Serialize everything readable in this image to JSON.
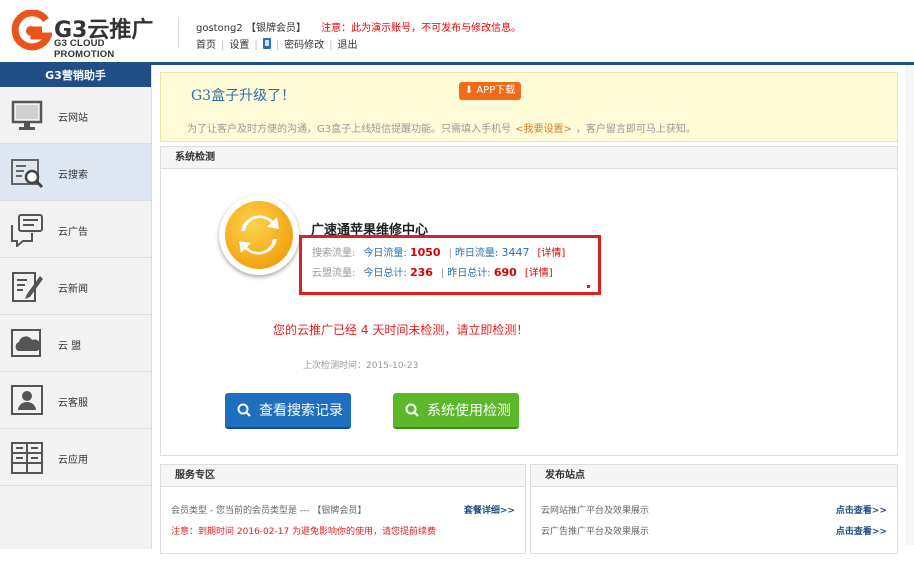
{
  "header": {
    "logo_title": "G3云推广",
    "logo_subtitle": "G3 CLOUD PROMOTION",
    "username": "gostong2",
    "member_level": "【银牌会员】",
    "demo_notice": "注意：此为演示账号，不可发布与修改信息。",
    "nav": [
      "首页",
      "设置",
      "密码修改",
      "退出"
    ]
  },
  "sidebar": {
    "title": "G3营销助手",
    "items": [
      {
        "label": "云网站",
        "icon": "monitor-icon"
      },
      {
        "label": "云搜索",
        "icon": "search-doc-icon"
      },
      {
        "label": "云广告",
        "icon": "chat-icon"
      },
      {
        "label": "云新闻",
        "icon": "edit-doc-icon"
      },
      {
        "label": "云 盟",
        "icon": "cloud-icon"
      },
      {
        "label": "云客服",
        "icon": "user-card-icon"
      },
      {
        "label": "云应用",
        "icon": "grid-icon"
      }
    ],
    "active_index": 1
  },
  "banner": {
    "title": "G3盒子升级了！",
    "app_button": "APP下载",
    "text_before": "为了让客户及时方便的沟通，G3盒子上线短信提醒功能。只需填入手机号",
    "link": "<我要设置>",
    "text_after": "，客户留言即可马上获知。"
  },
  "system_check": {
    "panel_title": "系统检测",
    "site_name": "广速通苹果维修中心",
    "search_traffic": {
      "key": "搜索流量:",
      "today_label": "今日流量:",
      "today_value": "1050",
      "yesterday_label": "昨日流量:",
      "yesterday_value": "3447",
      "detail": "[详情]"
    },
    "cloud_traffic": {
      "key": "云盟流量:",
      "today_label": "今日总计:",
      "today_value": "236",
      "yesterday_label": "昨日总计:",
      "yesterday_value": "690",
      "detail": "[详情]"
    },
    "warning_prefix": "您的云推广已经",
    "warning_days": "4",
    "warning_suffix": "天时间未检测，请立即检测！",
    "last_check": "上次检测时间：2015-10-23",
    "btn_search_records": "查看搜索记录",
    "btn_system_check": "系统使用检测"
  },
  "service": {
    "panel_title": "服务专区",
    "member_type": "会员类型 - 您当前的会员类型是 --- 【银牌会员】",
    "package_link": "套餐详细>>",
    "expire_notice": "注意：到期时间 2016-02-17 为避免影响你的使用，请您提前续费"
  },
  "publish": {
    "panel_title": "发布站点",
    "rows": [
      {
        "text": "云网站推广平台及效果展示",
        "link": "点击查看>>"
      },
      {
        "text": "云广告推广平台及效果展示",
        "link": "点击查看>>"
      }
    ]
  },
  "colors": {
    "brand_blue": "#1f4f86",
    "accent_orange": "#f06a1a",
    "alert_red": "#e02020",
    "green": "#5cb82a"
  }
}
